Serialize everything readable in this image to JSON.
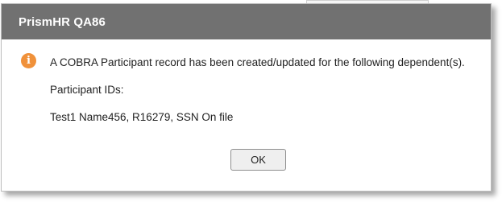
{
  "dialog": {
    "title": "PrismHR QA86",
    "message_line1": "A COBRA Participant record has been created/updated for the following dependent(s).",
    "participant_ids_label": "Participant IDs:",
    "participant_entry": "Test1 Name456, R16279, SSN On file",
    "ok_label": "OK",
    "icon": "info-icon",
    "header_color": "#717171",
    "icon_color": "#f0913a"
  }
}
